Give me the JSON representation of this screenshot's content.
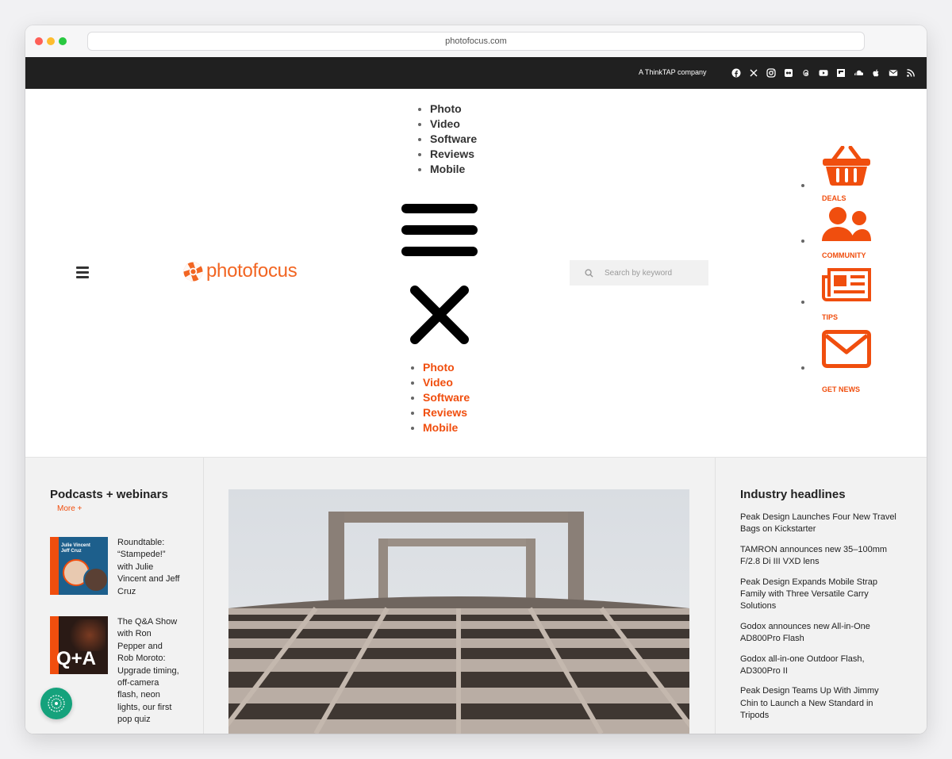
{
  "browser": {
    "url": "photofocus.com",
    "dots": {
      "close": "#fe5f57",
      "minimize": "#febc2e",
      "maximize": "#28c840"
    }
  },
  "topbar": {
    "company": "A ThinkTAP company",
    "social_icons": [
      "facebook-icon",
      "x-icon",
      "instagram-icon",
      "flickr-icon",
      "threads-icon",
      "youtube-icon",
      "flipboard-icon",
      "soundcloud-icon",
      "apple-icon",
      "email-icon",
      "rss-icon"
    ]
  },
  "brand": {
    "name": "photofocus",
    "accent": "#f04e0e",
    "logo_color": "#f26522"
  },
  "nav": {
    "primary": [
      "Photo",
      "Video",
      "Software",
      "Reviews",
      "Mobile"
    ],
    "mobile": [
      "Photo",
      "Video",
      "Software",
      "Reviews",
      "Mobile"
    ]
  },
  "search": {
    "placeholder": "Search by keyword"
  },
  "quick_links": [
    {
      "label": "DEALS",
      "icon": "basket-icon"
    },
    {
      "label": "COMMUNITY",
      "icon": "users-icon"
    },
    {
      "label": "TIPS",
      "icon": "newspaper-icon"
    },
    {
      "label": "GET NEWS",
      "icon": "envelope-icon"
    }
  ],
  "podcasts": {
    "heading": "Podcasts + webinars",
    "more": "More  +",
    "items": [
      {
        "title": "Roundtable: “Stampede!” with Julie Vincent and Jeff Cruz",
        "thumb_line1": "Julie Vincent",
        "thumb_line2": "Jeff Cruz"
      },
      {
        "title": "The Q&A Show with Ron Pepper and Rob Moroto: Upgrade timing, off-camera flash, neon lights, our first pop quiz",
        "thumb_text": "Q+A"
      }
    ]
  },
  "headlines": {
    "heading": "Industry headlines",
    "items": [
      "Peak Design Launches Four New Travel Bags on Kickstarter",
      "TAMRON announces new 35–100mm F/2.8 Di III VXD lens",
      "Peak Design Expands Mobile Strap Family with Three Versatile Carry Solutions",
      "Godox announces new All-in-One AD800Pro Flash",
      "Godox all-in-one Outdoor Flash, AD300Pro II",
      "Peak Design Teams Up With Jimmy Chin to Launch a New Standard in Tripods"
    ]
  }
}
